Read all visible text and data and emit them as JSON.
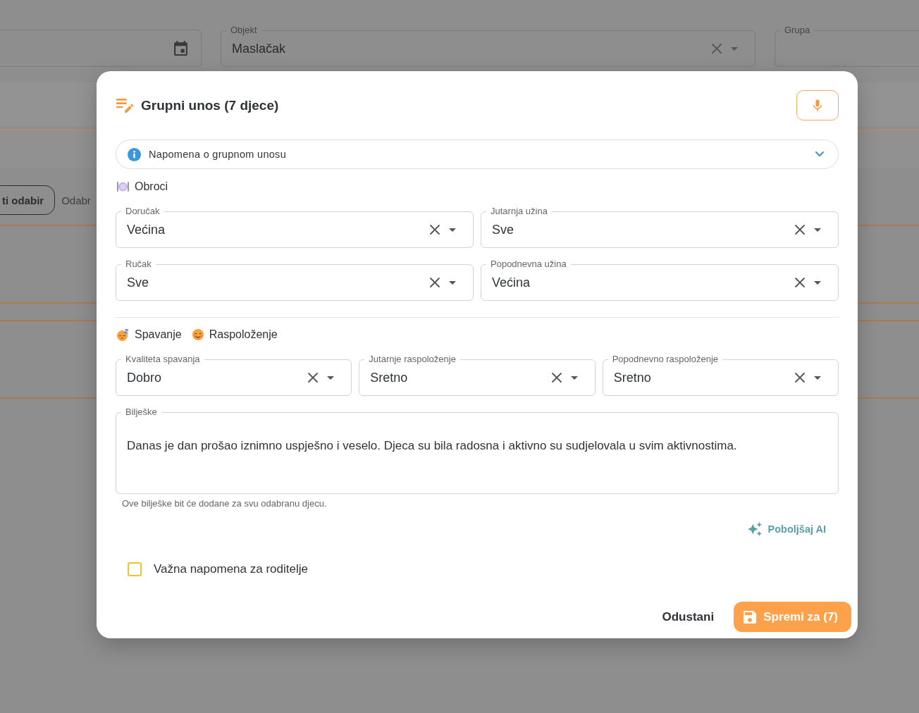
{
  "background": {
    "filters": [
      {
        "kind": "date"
      },
      {
        "kind": "select",
        "label": "Objekt",
        "value": "Maslačak"
      },
      {
        "kind": "select",
        "label": "Grupa"
      }
    ],
    "toolbar": {
      "button": "ti odabir",
      "text": "Odabr"
    }
  },
  "dialog": {
    "title": "Grupni unos (7 djece)",
    "info_panel": {
      "label": "Napomena o grupnom unosu",
      "expanded": false
    },
    "sections": [
      {
        "headings": [
          {
            "kind": "meals",
            "label": "Obroci"
          }
        ],
        "fields": [
          {
            "label": "Doručak",
            "value": "Većina"
          },
          {
            "label": "Jutarnja užina",
            "value": "Sve"
          },
          {
            "label": "Ručak",
            "value": "Sve"
          },
          {
            "label": "Popodnevna užina",
            "value": "Većina"
          }
        ]
      },
      {
        "headings": [
          {
            "kind": "sleep",
            "label": "Spavanje"
          },
          {
            "kind": "mood",
            "label": "Raspoloženje"
          }
        ],
        "fields": [
          {
            "label": "Kvaliteta spavanja",
            "value": "Dobro"
          },
          {
            "label": "Jutarnje raspoloženje",
            "value": "Sretno"
          },
          {
            "label": "Popodnevno raspoloženje",
            "value": "Sretno"
          }
        ]
      }
    ],
    "notes": {
      "label": "Bilješke",
      "value": "Danas je dan prošao iznimno uspješno i veselo. Djeca su bila radosna i aktivno su sudjelovala u svim aktivnostima.",
      "helper": "Ove bilješke bit će dodane za svu odabranu djecu."
    },
    "improve_button": "Poboljšaj AI",
    "important_checkbox": {
      "label": "Važna napomena za roditelje",
      "checked": false
    },
    "cancel_button": "Odustani",
    "save_button": "Spremi za (7)"
  }
}
